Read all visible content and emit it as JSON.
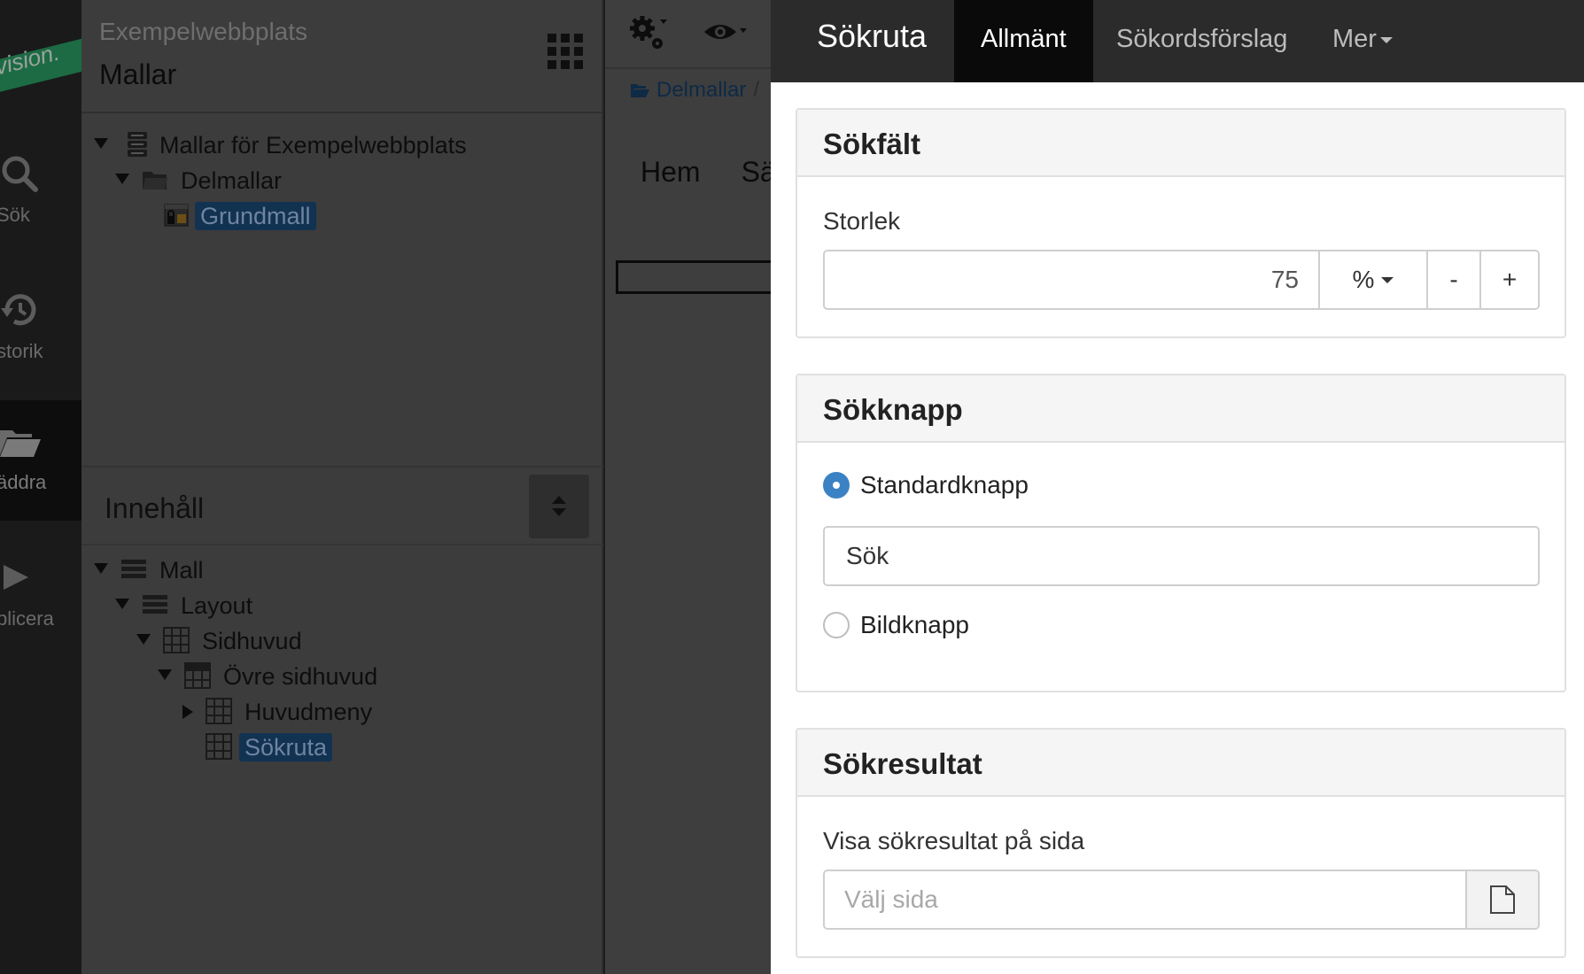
{
  "rail": {
    "brand": "vision.",
    "items": [
      {
        "icon": "search-icon",
        "label": "Sök"
      },
      {
        "icon": "history-icon",
        "label": "storik"
      },
      {
        "icon": "folder-icon",
        "label": "äddra"
      },
      {
        "icon": "play-icon",
        "label": "plicera"
      }
    ]
  },
  "tree_panel": {
    "site_name": "Exempelwebbplats",
    "section_title": "Mallar",
    "templates_tree": [
      {
        "label": "Mallar för Exempelwebbplats",
        "icon": "server-icon"
      },
      {
        "label": "Delmallar",
        "icon": "folder-icon"
      },
      {
        "label": "Grundmall",
        "icon": "template-icon",
        "selected": true
      }
    ],
    "content_title": "Innehåll",
    "content_tree": [
      {
        "label": "Mall",
        "icon": "list-icon"
      },
      {
        "label": "Layout",
        "icon": "list-icon"
      },
      {
        "label": "Sidhuvud",
        "icon": "grid-icon"
      },
      {
        "label": "Övre sidhuvud",
        "icon": "grid-icon"
      },
      {
        "label": "Huvudmeny",
        "icon": "grid-icon"
      },
      {
        "label": "Sökruta",
        "icon": "grid-icon",
        "selected": true
      }
    ]
  },
  "preview": {
    "breadcrumb": "Delmallar",
    "breadcrumb_sep": "/",
    "nav": [
      "Hem",
      "Sä"
    ]
  },
  "panel": {
    "title": "Sökruta",
    "tabs": [
      {
        "label": "Allmänt",
        "active": true
      },
      {
        "label": "Sökordsförslag",
        "active": false
      },
      {
        "label": "Mer",
        "active": false
      }
    ],
    "search_field": {
      "heading": "Sökfält",
      "size_label": "Storlek",
      "size_value": "75",
      "unit": "%",
      "decrement": "-",
      "increment": "+"
    },
    "search_button": {
      "heading": "Sökknapp",
      "option_standard": "Standardknapp",
      "button_text": "Sök",
      "option_image": "Bildknapp",
      "selected": "Standardknapp"
    },
    "search_result": {
      "heading": "Sökresultat",
      "page_label": "Visa sökresultat på sida",
      "page_placeholder": "Välj sida"
    }
  },
  "colors": {
    "accent": "#3b82c4",
    "selection": "#123252",
    "header_dark": "#2b2b2b"
  }
}
